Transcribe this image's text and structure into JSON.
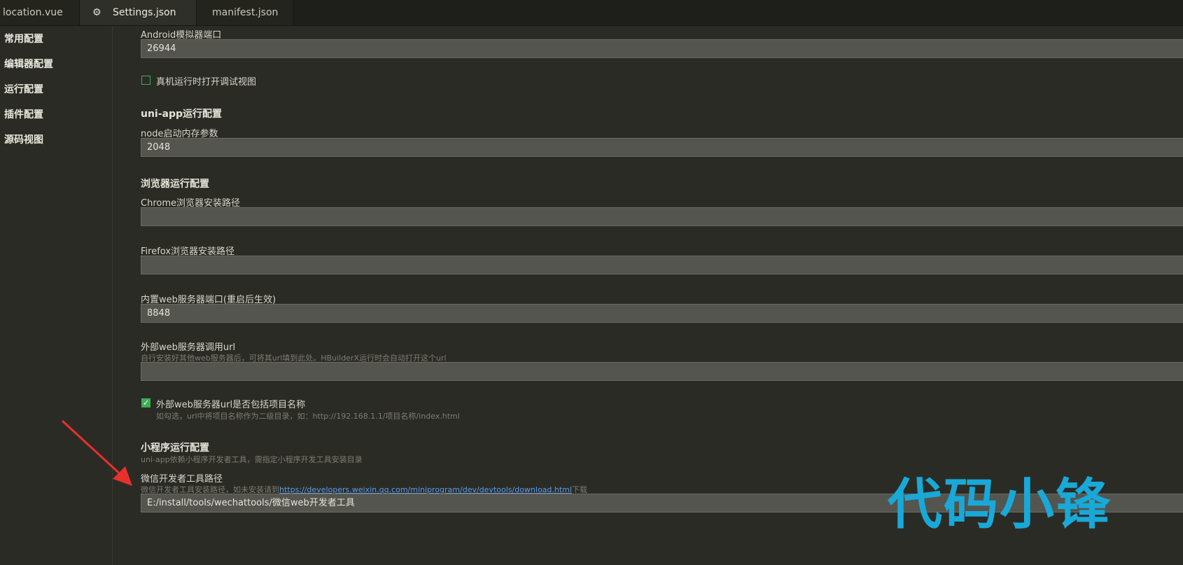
{
  "tabs": [
    {
      "label": "location.vue",
      "active": false,
      "icon": ""
    },
    {
      "label": "Settings.json",
      "active": true,
      "icon": "gear-icon"
    },
    {
      "label": "manifest.json",
      "active": false,
      "icon": ""
    }
  ],
  "sidebar": {
    "items": [
      {
        "label": "常用配置"
      },
      {
        "label": "编辑器配置"
      },
      {
        "label": "运行配置"
      },
      {
        "label": "插件配置"
      },
      {
        "label": "源码视图"
      }
    ]
  },
  "settings": {
    "android_port": {
      "label": "Android模拟器端口",
      "value": "26944"
    },
    "debug_view": {
      "label": "真机运行时打开调试视图",
      "checked": false
    },
    "uniapp_section": {
      "title": "uni-app运行配置"
    },
    "node_memory": {
      "label": "node启动内存参数",
      "value": "2048"
    },
    "browser_section": {
      "title": "浏览器运行配置"
    },
    "chrome_path": {
      "label": "Chrome浏览器安装路径",
      "value": ""
    },
    "firefox_path": {
      "label": "Firefox浏览器安装路径",
      "value": ""
    },
    "web_port": {
      "label": "内置web服务器端口(重启后生效)",
      "value": "8848"
    },
    "external_url": {
      "label": "外部web服务器调用url",
      "desc": "自行安装好其他web服务器后，可将其url填到此处。HBuilderX运行时会自动打开这个url",
      "value": ""
    },
    "include_project": {
      "label": "外部web服务器url是否包括项目名称",
      "desc": "如勾选，url中将项目名称作为二级目录，如：http://192.168.1.1/项目名称/index.html",
      "checked": true
    },
    "miniprogram_section": {
      "title": "小程序运行配置",
      "desc": "uni-app依赖小程序开发者工具，需指定小程序开发工具安装目录"
    },
    "wechat_path": {
      "label": "微信开发者工具路径",
      "desc_prefix": "微信开发者工具安装路径，如未安装请到",
      "desc_link": "https://developers.weixin.qq.com/miniprogram/dev/devtools/download.html",
      "desc_suffix": "下载",
      "value": "E:/install/tools/wechattools/微信web开发者工具"
    }
  },
  "watermark": {
    "text": "代码小锋",
    "color": "#18a9d8"
  },
  "annotation": {
    "icon": "red-arrow-icon",
    "color": "#e8312a"
  }
}
